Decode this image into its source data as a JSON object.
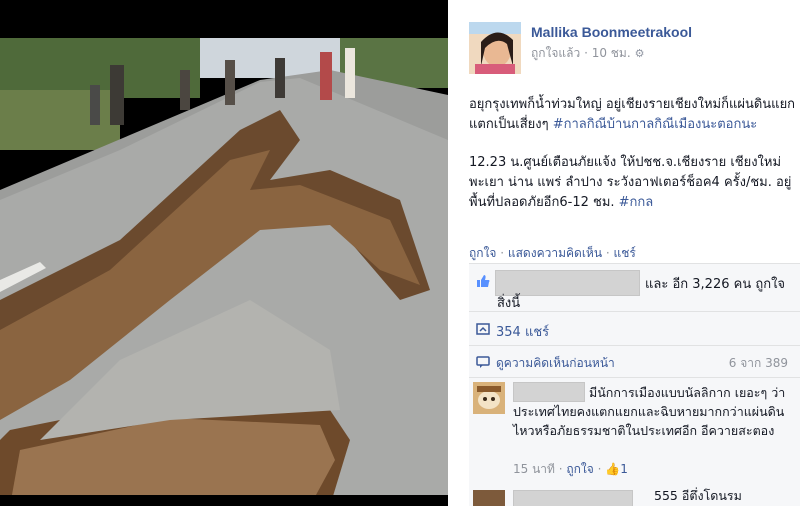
{
  "post": {
    "author": "Mallika Boonmeetrakool",
    "meta_like": "ถูกใจแล้ว",
    "meta_sep": " · ",
    "meta_time": "10 ชม.",
    "paragraph1": "อยุกรุงเทพก็น้ำท่วมใหญ่ อยู่เชียงรายเชียงใหม่ก็แผ่นดินแยกแตกเป็นเสี่ยงๆ ",
    "hashtag1": "#กาลกิณีบ้านกาลกิณีเมืองนะตอกนะ",
    "paragraph2": "12.23 น.ศูนย์เตือนภัยแจ้ง ให้ปชช.จ.เชียงราย เชียงใหม่ พะเยา น่าน แพร่ ลำปาง ระวังอาฟเตอร์ช็อค4 ครั้ง/ชม. อยู่พื้นที่ปลอดภัยอีก6-12 ชม. ",
    "hashtag2": "#กกล"
  },
  "actions": {
    "like": "ถูกใจ",
    "comment": "แสดงความคิดเห็น",
    "share": "แชร์",
    "sep": " · "
  },
  "feedback": {
    "likes_line1": "และ อีก 3,226 คน ถูกใจ",
    "likes_line2": "สิ่งนี้",
    "shares": "354 แชร์",
    "view_previous": "ดูความคิดเห็นก่อนหน้า",
    "count": "6 จาก 389"
  },
  "comment1": {
    "text": "มีนักการเมืองแบบนัลลิกาก เยอะๆ ว่าประเทศไทยคงแตกแยกและฉิบหายมากกว่าแผ่นดินไหวหรือภัยธรรมชาติในประเทศอีก อีควายสะตอง",
    "time": "15 นาที",
    "like": "ถูกใจ",
    "likes_count": "1",
    "sep": " · "
  },
  "comment2": {
    "text": "555 อีตึ่งโดนรม"
  },
  "colors": {
    "link": "#3b5998",
    "text": "#141823",
    "muted": "#90949c",
    "feedback_bg": "#f6f7f9"
  }
}
